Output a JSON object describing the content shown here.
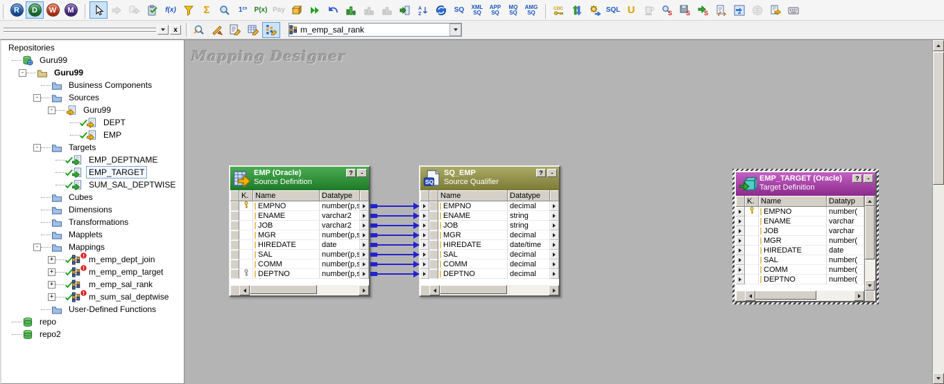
{
  "canvas": {
    "watermark": "Mapping Designer"
  },
  "toolbar_main": {
    "groups": [
      {
        "name": "applications",
        "items": [
          {
            "kind": "app",
            "name": "repository-manager-app",
            "letter": "R",
            "bg": "#1a5fb4"
          },
          {
            "kind": "app",
            "name": "designer-app",
            "letter": "D",
            "bg": "#21813b",
            "selected": true
          },
          {
            "kind": "app",
            "name": "workflow-manager-app",
            "letter": "W",
            "bg": "#cf3f1e"
          },
          {
            "kind": "app",
            "name": "workflow-monitor-app",
            "letter": "M",
            "bg": "#4f2d8f"
          }
        ]
      },
      {
        "name": "transformation-tools",
        "items": [
          {
            "kind": "icon",
            "name": "select-tool",
            "icon": "pointer",
            "selected": true
          },
          {
            "kind": "icon",
            "name": "link-ports-tool",
            "icon": "gray-arrow",
            "disabled": true
          },
          {
            "kind": "icon",
            "name": "propagate-attributes-tool",
            "icon": "gray-arrow2",
            "disabled": true
          },
          {
            "kind": "icon",
            "name": "validate-mapping-tool",
            "icon": "clipboard"
          },
          {
            "kind": "text",
            "name": "expression-transformation-tool",
            "text": "f(x)",
            "color": "#1a55c0",
            "italic": true
          },
          {
            "kind": "icon",
            "name": "filter-transformation-tool",
            "icon": "funnel"
          },
          {
            "kind": "text",
            "name": "aggregator-transformation-tool",
            "text": "Σ",
            "color": "#dd9f00",
            "size": 15
          },
          {
            "kind": "icon",
            "name": "lookup-transformation-tool",
            "icon": "magnifier"
          },
          {
            "kind": "text",
            "name": "sequence-generator-tool",
            "text": "1²³",
            "color": "#1a55c0"
          },
          {
            "kind": "text",
            "name": "rank-transformation-tool",
            "text": "P(x)",
            "color": "#1f7a1f"
          },
          {
            "kind": "text",
            "name": "update-strategy-tool",
            "text": "Pay",
            "color": "#8f8f8f",
            "disabled": true
          },
          {
            "kind": "icon",
            "name": "joiner-transformation-tool",
            "icon": "box-yellow"
          },
          {
            "kind": "icon",
            "name": "normalizer-transformation-tool",
            "icon": "chev-green"
          },
          {
            "kind": "icon",
            "name": "undo-tool",
            "icon": "undo"
          },
          {
            "kind": "icon",
            "name": "router-transformation-tool",
            "icon": "bars-green"
          },
          {
            "kind": "icon",
            "name": "custom-transformation-tool",
            "icon": "bars-gray",
            "disabled": true
          },
          {
            "kind": "icon",
            "name": "external-procedure-tool",
            "icon": "bars-gray",
            "disabled": true
          },
          {
            "kind": "icon",
            "name": "stored-procedure-tool",
            "icon": "panel-arrow"
          },
          {
            "kind": "icon",
            "name": "sorter-transformation-tool",
            "icon": "sorter-az"
          },
          {
            "kind": "icon",
            "name": "transaction-control-tool",
            "icon": "refresh-globe"
          },
          {
            "kind": "text",
            "name": "source-qualifier-tool",
            "text": "SQ",
            "color": "#1a55c0"
          },
          {
            "kind": "text2",
            "name": "xml-source-qualifier-tool",
            "lines": [
              "XML",
              "SQ"
            ],
            "color": "#1a55c0"
          },
          {
            "kind": "text2",
            "name": "application-source-qualifier-tool",
            "lines": [
              "APP",
              "SQ"
            ],
            "color": "#1a55c0"
          },
          {
            "kind": "text2",
            "name": "mq-source-qualifier-tool",
            "lines": [
              "MQ",
              "SQ"
            ],
            "color": "#1a55c0"
          },
          {
            "kind": "text2",
            "name": "amg-source-qualifier-tool",
            "lines": [
              "AMG",
              "SQ"
            ],
            "color": "#1a55c0"
          }
        ]
      },
      {
        "name": "advanced-tools",
        "items": [
          {
            "kind": "icon",
            "name": "cdc-tool",
            "icon": "cdc"
          },
          {
            "kind": "icon",
            "name": "xml-generator-tool",
            "icon": "arrows-colored"
          },
          {
            "kind": "icon",
            "name": "mapping-wizard-tool",
            "icon": "gear-arrow"
          },
          {
            "kind": "text",
            "name": "sql-transformation-tool",
            "text": "SQL",
            "color": "#1a55c0"
          },
          {
            "kind": "text",
            "name": "union-transformation-tool",
            "text": "U",
            "color": "#dd9f00",
            "size": 15
          },
          {
            "kind": "icon",
            "name": "java-transformation-tool",
            "icon": "cup",
            "disabled": true
          },
          {
            "kind": "icon",
            "name": "find-tool",
            "icon": "mag-s"
          },
          {
            "kind": "icon",
            "name": "save-results-tool",
            "icon": "disk-s"
          },
          {
            "kind": "icon",
            "name": "run-query-tool",
            "icon": "arrow-s"
          },
          {
            "kind": "icon",
            "name": "refresh-objects-tool",
            "icon": "doc-refresh"
          },
          {
            "kind": "icon",
            "name": "compare-objects-tool",
            "icon": "arrows-blue"
          },
          {
            "kind": "icon",
            "name": "web-services-tool",
            "icon": "globe-gray",
            "disabled": true
          },
          {
            "kind": "icon",
            "name": "export-object-tool",
            "icon": "doc-export"
          },
          {
            "kind": "icon",
            "name": "keyboard-shortcuts-tool",
            "icon": "keyboard"
          }
        ]
      }
    ]
  },
  "toolbar_mapping": {
    "items": [
      {
        "kind": "icon",
        "name": "zoom-tool",
        "icon": "mag-zoom"
      },
      {
        "kind": "icon",
        "name": "arrange-workspace-tool",
        "icon": "ruler-pencil"
      },
      {
        "kind": "icon",
        "name": "edit-list-tool",
        "icon": "list-pencil"
      },
      {
        "kind": "icon",
        "name": "edit-table-tool",
        "icon": "table-pencil"
      },
      {
        "kind": "icon",
        "name": "edit-mapping-tool",
        "icon": "mapping-pencil",
        "selected": true
      }
    ],
    "combobox": {
      "value": "m_emp_sal_rank"
    }
  },
  "tree": {
    "items": [
      {
        "label": "Repositories",
        "level": 0
      },
      {
        "label": "Guru99",
        "level": 1,
        "icon": "db-globe"
      },
      {
        "label": "Guru99",
        "level": 2,
        "icon": "folder-khaki",
        "expander": "minus",
        "bold": true
      },
      {
        "label": "Business Components",
        "level": 3,
        "icon": "folder-blue"
      },
      {
        "label": "Sources",
        "level": 3,
        "icon": "folder-blue",
        "expander": "minus"
      },
      {
        "label": "Guru99",
        "level": 4,
        "icon": "doc-source",
        "expander": "minus"
      },
      {
        "label": "DEPT",
        "level": 5,
        "icon": "doc-source",
        "check": true
      },
      {
        "label": "EMP",
        "level": 5,
        "icon": "doc-source",
        "check": true
      },
      {
        "label": "Targets",
        "level": 3,
        "icon": "folder-blue",
        "expander": "minus"
      },
      {
        "label": "EMP_DEPTNAME",
        "level": 4,
        "icon": "doc-target",
        "check": true
      },
      {
        "label": "EMP_TARGET",
        "level": 4,
        "icon": "doc-target",
        "check": true,
        "selected": true
      },
      {
        "label": "SUM_SAL_DEPTWISE",
        "level": 4,
        "icon": "doc-target",
        "check": true
      },
      {
        "label": "Cubes",
        "level": 3,
        "icon": "folder-blue"
      },
      {
        "label": "Dimensions",
        "level": 3,
        "icon": "folder-blue"
      },
      {
        "label": "Transformations",
        "level": 3,
        "icon": "folder-blue"
      },
      {
        "label": "Mapplets",
        "level": 3,
        "icon": "folder-blue"
      },
      {
        "label": "Mappings",
        "level": 3,
        "icon": "folder-blue",
        "expander": "minus"
      },
      {
        "label": "m_emp_dept_join",
        "level": 4,
        "icon": "mapping-grid",
        "expander": "plus",
        "check": true,
        "badge": true
      },
      {
        "label": "m_emp_emp_target",
        "level": 4,
        "icon": "mapping-grid",
        "expander": "plus",
        "check": true,
        "badge": true
      },
      {
        "label": "m_emp_sal_rank",
        "level": 4,
        "icon": "mapping-grid",
        "expander": "plus",
        "check": true
      },
      {
        "label": "m_sum_sal_deptwise",
        "level": 4,
        "icon": "mapping-grid",
        "expander": "plus",
        "check": true,
        "badge": true
      },
      {
        "label": "User-Defined Functions",
        "level": 3,
        "icon": "folder-blue"
      },
      {
        "label": "repo",
        "level": 1,
        "icon": "db-green"
      },
      {
        "label": "repo2",
        "level": 1,
        "icon": "db-green"
      }
    ]
  },
  "transformations": [
    {
      "id": "EMP",
      "title": "EMP (Oracle)",
      "subtitle": "Source Definition",
      "type": "source",
      "icon": "src-header",
      "header_from": "#4aac52",
      "header_to": "#1e7a27",
      "columns": {
        "key": "K.",
        "name": "Name",
        "datatype": "Datatype"
      },
      "buttons": {
        "help": "?",
        "minimize": "-"
      },
      "rows": [
        {
          "key": "pk",
          "name": "EMPNO",
          "datatype": "number(p,s"
        },
        {
          "name": "ENAME",
          "datatype": "varchar2"
        },
        {
          "name": "JOB",
          "datatype": "varchar2"
        },
        {
          "name": "MGR",
          "datatype": "number(p,s"
        },
        {
          "name": "HIREDATE",
          "datatype": "date"
        },
        {
          "name": "SAL",
          "datatype": "number(p,s"
        },
        {
          "name": "COMM",
          "datatype": "number(p,s"
        },
        {
          "key": "fk",
          "name": "DEPTNO",
          "datatype": "number(p,s"
        }
      ]
    },
    {
      "id": "SQ_EMP",
      "title": "SQ_EMP",
      "subtitle": "Source Qualifier",
      "type": "qualifier",
      "icon": "sq-header",
      "header_from": "#aaaa64",
      "header_to": "#7b7b36",
      "columns": {
        "name": "Name",
        "datatype": "Datatype"
      },
      "buttons": {
        "help": "?",
        "minimize": "-"
      },
      "rows": [
        {
          "name": "EMPNO",
          "datatype": "decimal"
        },
        {
          "name": "ENAME",
          "datatype": "string"
        },
        {
          "name": "JOB",
          "datatype": "string"
        },
        {
          "name": "MGR",
          "datatype": "decimal"
        },
        {
          "name": "HIREDATE",
          "datatype": "date/time"
        },
        {
          "name": "SAL",
          "datatype": "decimal"
        },
        {
          "name": "COMM",
          "datatype": "decimal"
        },
        {
          "name": "DEPTNO",
          "datatype": "decimal"
        }
      ]
    },
    {
      "id": "EMP_TARGET",
      "title": "EMP_TARGET (Oracle)",
      "subtitle": "Target Definition",
      "type": "target",
      "icon": "tgt-header",
      "header_from": "#c360c3",
      "header_to": "#8c2a8c",
      "columns": {
        "key": "K.",
        "name": "Name",
        "datatype": "Datatyp"
      },
      "buttons": {
        "help": "?",
        "minimize": "-"
      },
      "rows": [
        {
          "key": "pk",
          "name": "EMPNO",
          "datatype": "number("
        },
        {
          "name": "ENAME",
          "datatype": "varchar"
        },
        {
          "name": "JOB",
          "datatype": "varchar"
        },
        {
          "name": "MGR",
          "datatype": "number("
        },
        {
          "name": "HIREDATE",
          "datatype": "date"
        },
        {
          "name": "SAL",
          "datatype": "number("
        },
        {
          "name": "COMM",
          "datatype": "number("
        },
        {
          "name": "DEPTNO",
          "datatype": "number("
        }
      ]
    }
  ],
  "connections": {
    "from": "EMP",
    "to": "SQ_EMP",
    "pairs": [
      [
        "EMPNO",
        "EMPNO"
      ],
      [
        "ENAME",
        "ENAME"
      ],
      [
        "JOB",
        "JOB"
      ],
      [
        "MGR",
        "MGR"
      ],
      [
        "HIREDATE",
        "HIREDATE"
      ],
      [
        "SAL",
        "SAL"
      ],
      [
        "COMM",
        "COMM"
      ],
      [
        "DEPTNO",
        "DEPTNO"
      ]
    ]
  }
}
